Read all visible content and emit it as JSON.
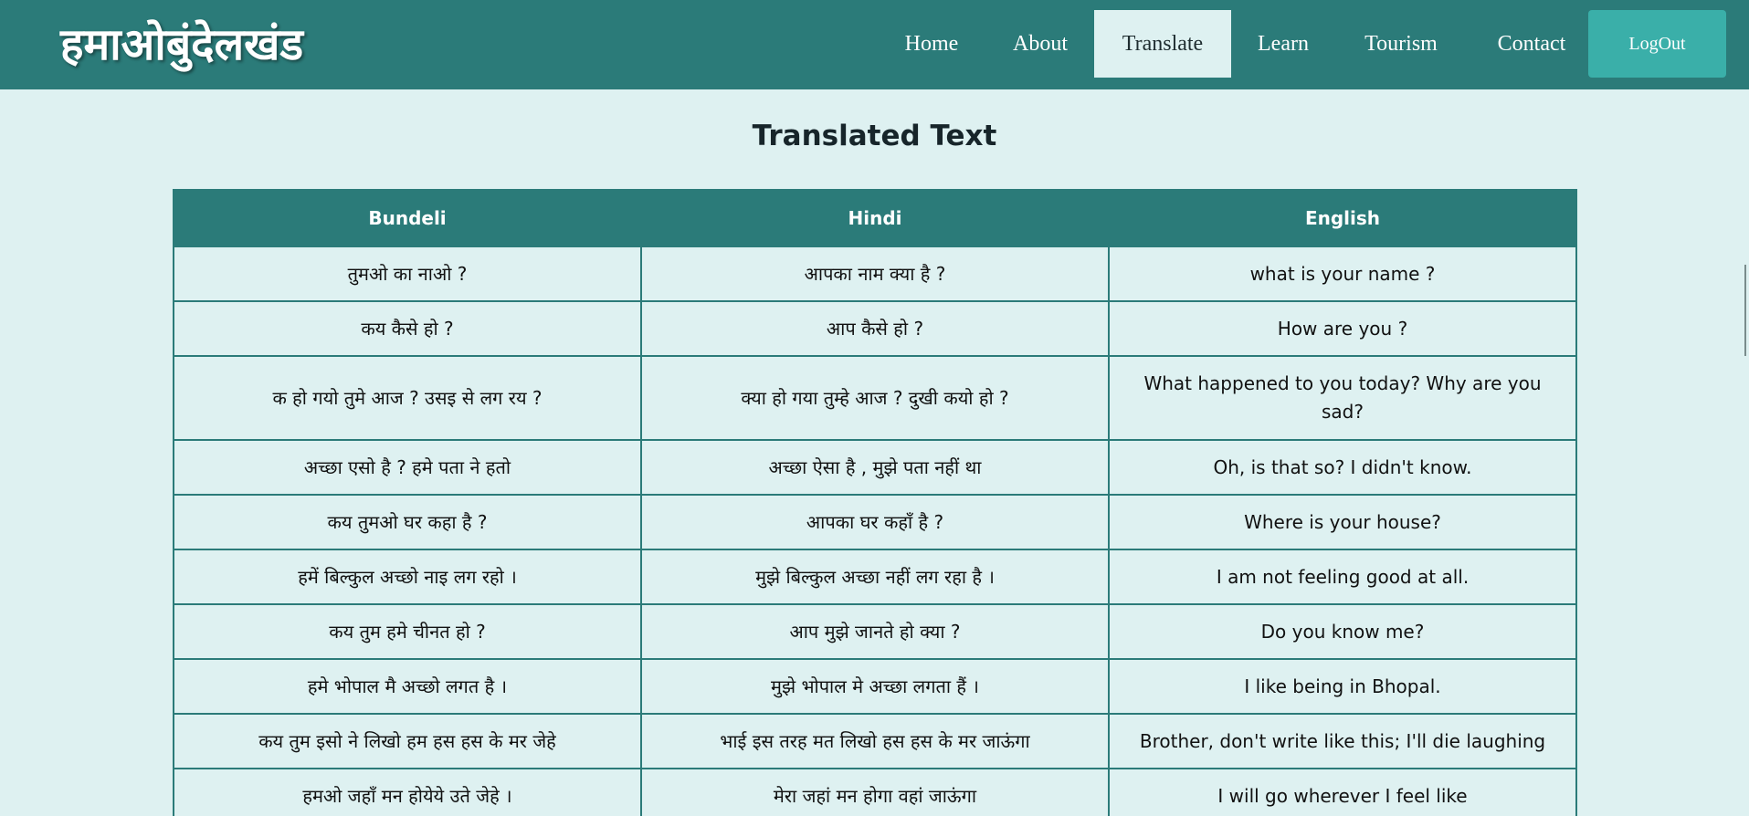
{
  "brand": "हमाओबुंदेलखंड",
  "nav": {
    "home": "Home",
    "about": "About",
    "translate": "Translate",
    "learn": "Learn",
    "tourism": "Tourism",
    "contact": "Contact",
    "logout": "LogOut",
    "active": "translate"
  },
  "page_title": "Translated Text",
  "table": {
    "headers": [
      "Bundeli",
      "Hindi",
      "English"
    ],
    "rows": [
      [
        "तुमओ का नाओ ?",
        "आपका नाम क्या है ?",
        "what is your name ?"
      ],
      [
        "कय कैसे हो ?",
        "आप कैसे हो ?",
        "How are you ?"
      ],
      [
        "क हो गयो तुमे आज ? उसइ से लग रय ?",
        "क्या हो गया तुम्हे आज ? दुखी कयो हो ?",
        "What happened to you today? Why are you sad?"
      ],
      [
        "अच्छा एसो है ? हमे पता ने हतो",
        "अच्छा ऐसा है , मुझे पता नहीं था",
        "Oh, is that so? I didn't know."
      ],
      [
        "कय तुमओ घर कहा है ?",
        "आपका घर कहाँ है ?",
        "Where is your house?"
      ],
      [
        "हमें बिल्कुल अच्छो नाइ लग रहो ।",
        "मुझे बिल्कुल अच्छा नहीं लग रहा है ।",
        "I am not feeling good at all."
      ],
      [
        "कय तुम हमे चीनत हो ?",
        "आप मुझे जानते हो क्या ?",
        "Do you know me?"
      ],
      [
        "हमे भोपाल मै अच्छो लगत है ।",
        "मुझे भोपाल मे अच्छा लगता हैं ।",
        "I like being in Bhopal."
      ],
      [
        "कय तुम इसो ने लिखो हम हस हस के मर जेहे",
        "भाई इस तरह मत लिखो हस हस के मर जाऊंगा",
        "Brother, don't write like this; I'll die laughing"
      ],
      [
        "हमओ जहाँ मन होयेये उते जेहे ।",
        "मेरा जहां मन होगा वहां जाऊंगा",
        "I will go wherever I feel like"
      ]
    ]
  },
  "colors": {
    "nav_background": "#2b7b79",
    "page_background": "#def1f1",
    "logout_background": "#3aafa9",
    "table_border": "#2b7b79"
  }
}
